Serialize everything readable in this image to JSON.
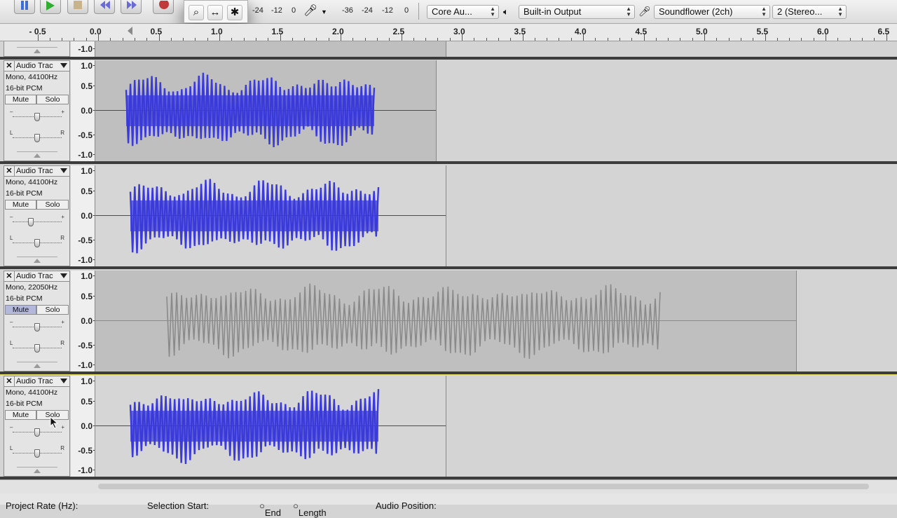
{
  "toolbar": {
    "meter_left": [
      "-24",
      "-12",
      "0"
    ],
    "meter_right": [
      "-36",
      "-24",
      "-12",
      "0"
    ],
    "host": "Core Au...",
    "output_device": "Built-in Output",
    "input_device": "Soundflower (2ch)",
    "channels": "2 (Stereo..."
  },
  "ruler": {
    "labels": [
      "- 0.5",
      "0.0",
      "0.5",
      "1.0",
      "1.5",
      "2.0",
      "2.5",
      "3.0",
      "3.5",
      "4.0",
      "4.5",
      "5.0",
      "5.5",
      "6.0",
      "6.5"
    ]
  },
  "tracks": [
    {
      "name": "Audio Trac",
      "rate": "Mono, 44100Hz",
      "format": "16-bit PCM",
      "mute": "Mute",
      "solo": "Solo",
      "mute_active": false,
      "color": "#3b3bdb"
    },
    {
      "name": "Audio Trac",
      "rate": "Mono, 44100Hz",
      "format": "16-bit PCM",
      "mute": "Mute",
      "solo": "Solo",
      "mute_active": false,
      "color": "#3b3bdb"
    },
    {
      "name": "Audio Trac",
      "rate": "Mono, 22050Hz",
      "format": "16-bit PCM",
      "mute": "Mute",
      "solo": "Solo",
      "mute_active": true,
      "color": "#8a8a8a"
    },
    {
      "name": "Audio Trac",
      "rate": "Mono, 44100Hz",
      "format": "16-bit PCM",
      "mute": "Mute",
      "solo": "Solo",
      "mute_active": false,
      "color": "#3b3bdb"
    }
  ],
  "amp_labels": [
    "1.0",
    "0.5",
    "0.0",
    "-0.5",
    "-1.0"
  ],
  "top_partial_label": "-1.0",
  "status": {
    "project_rate": "Project Rate (Hz):",
    "selection_start": "Selection Start:",
    "end": "End",
    "length": "Length",
    "audio_position": "Audio Position:"
  }
}
